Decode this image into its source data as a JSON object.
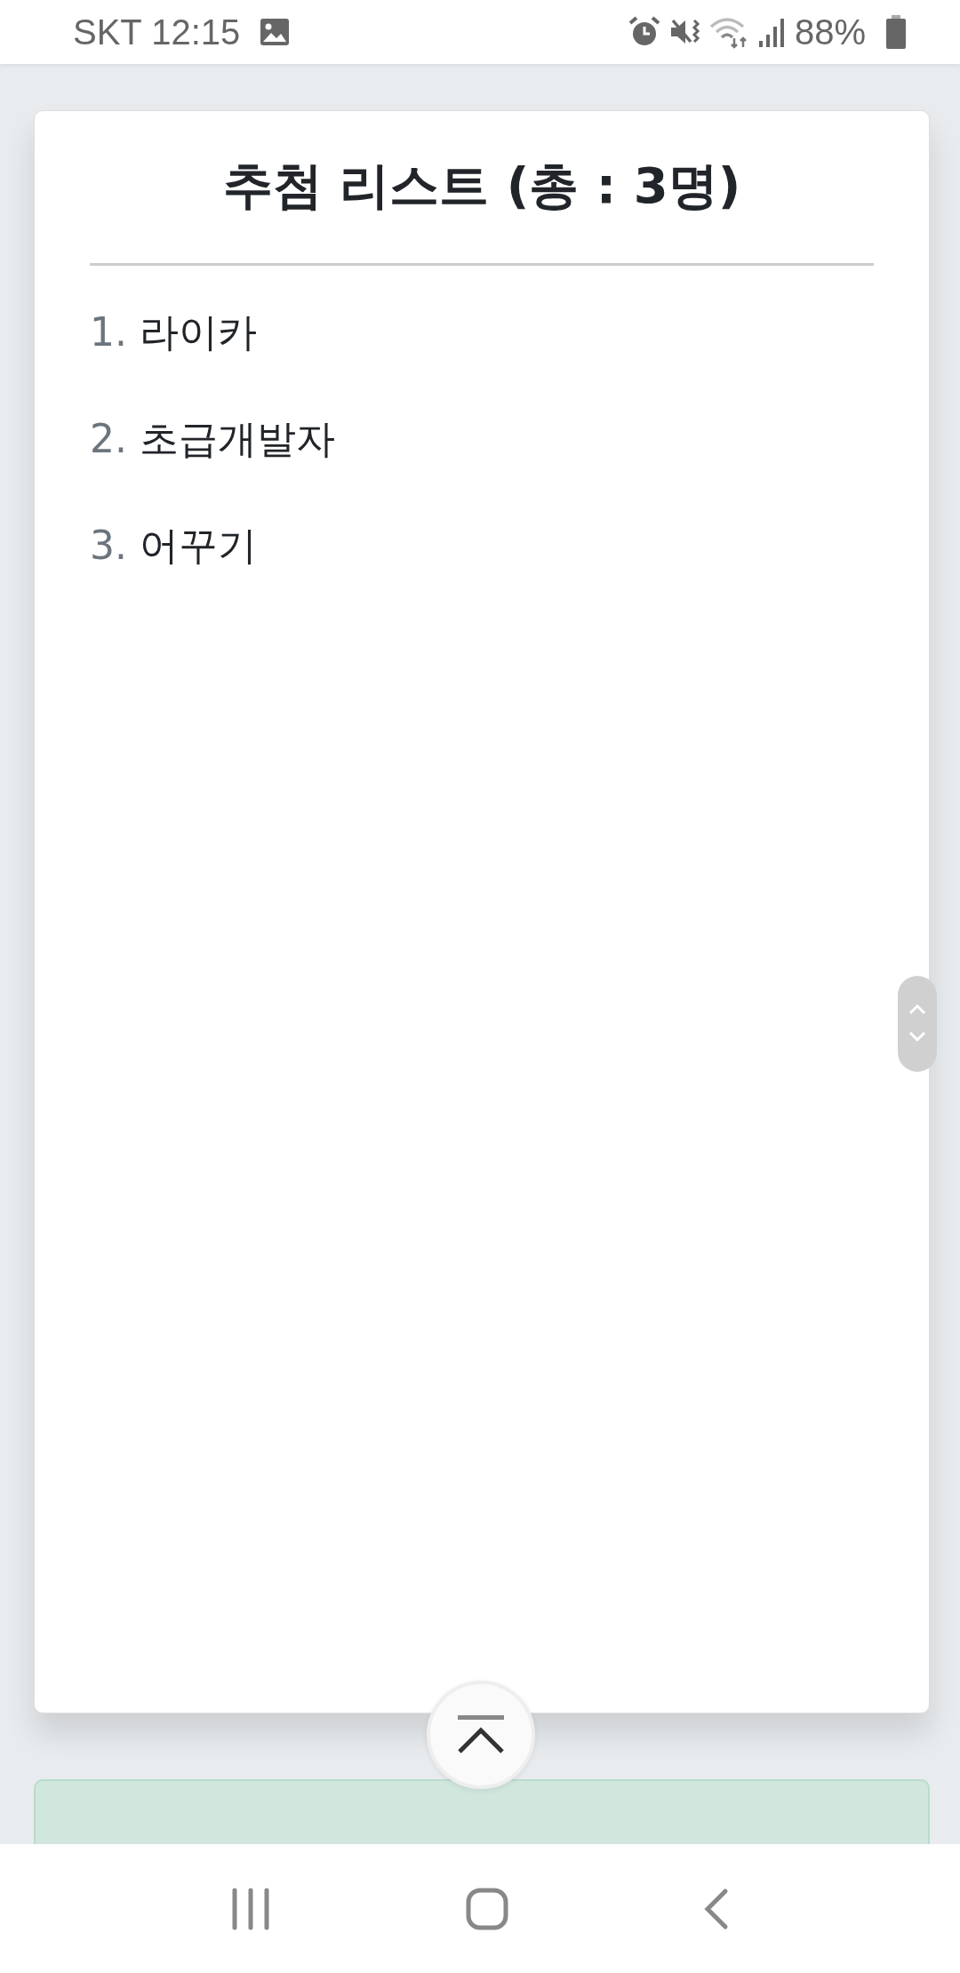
{
  "status_bar": {
    "carrier": "SKT",
    "time": "12:15",
    "battery": "88%"
  },
  "card": {
    "title": "추첨 리스트 (총 : 3명)",
    "items": [
      {
        "number": "1.",
        "name": "라이카"
      },
      {
        "number": "2.",
        "name": "초급개발자"
      },
      {
        "number": "3.",
        "name": "어꾸기"
      }
    ]
  },
  "alert": {
    "kind": "success"
  }
}
